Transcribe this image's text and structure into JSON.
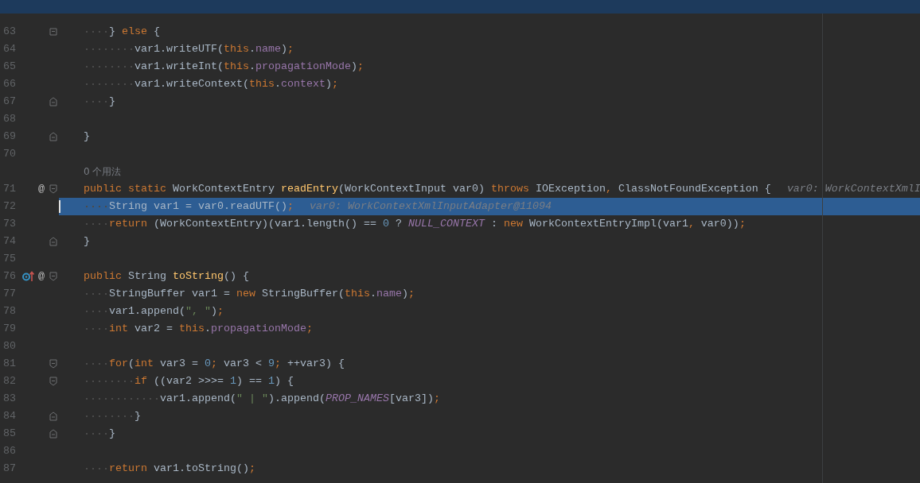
{
  "editor": {
    "rows": [
      {
        "kind": "code",
        "number": "63",
        "fold_start": true,
        "fold_end": true,
        "tokens": [
          {
            "text": "    } ",
            "kind": "plain"
          },
          {
            "text": "else",
            "kind": "keyword"
          },
          {
            "text": " {",
            "kind": "plain"
          }
        ]
      },
      {
        "kind": "code",
        "number": "64",
        "tokens": [
          {
            "text": "        var1.writeUTF(",
            "kind": "plain"
          },
          {
            "text": "this",
            "kind": "keyword"
          },
          {
            "text": ".",
            "kind": "plain"
          },
          {
            "text": "name",
            "kind": "field"
          },
          {
            "text": ")",
            "kind": "plain"
          },
          {
            "text": ";",
            "kind": "keyword"
          }
        ]
      },
      {
        "kind": "code",
        "number": "65",
        "tokens": [
          {
            "text": "        var1.writeInt(",
            "kind": "plain"
          },
          {
            "text": "this",
            "kind": "keyword"
          },
          {
            "text": ".",
            "kind": "plain"
          },
          {
            "text": "propagationMode",
            "kind": "field"
          },
          {
            "text": ")",
            "kind": "plain"
          },
          {
            "text": ";",
            "kind": "keyword"
          }
        ]
      },
      {
        "kind": "code",
        "number": "66",
        "tokens": [
          {
            "text": "        var1.writeContext(",
            "kind": "plain"
          },
          {
            "text": "this",
            "kind": "keyword"
          },
          {
            "text": ".",
            "kind": "plain"
          },
          {
            "text": "context",
            "kind": "field"
          },
          {
            "text": ")",
            "kind": "plain"
          },
          {
            "text": ";",
            "kind": "keyword"
          }
        ]
      },
      {
        "kind": "code",
        "number": "67",
        "fold_end": true,
        "tokens": [
          {
            "text": "    }",
            "kind": "plain"
          }
        ]
      },
      {
        "kind": "code",
        "number": "68"
      },
      {
        "kind": "code",
        "number": "69",
        "fold_end": true,
        "tokens": [
          {
            "text": "}",
            "kind": "plain"
          }
        ]
      },
      {
        "kind": "code",
        "number": "70"
      },
      {
        "kind": "usages",
        "text": "0 个用法"
      },
      {
        "kind": "code",
        "number": "71",
        "fold_start": true,
        "markers": [
          {
            "kind": "text",
            "text": "@"
          }
        ],
        "tokens": [
          {
            "text": "public",
            "kind": "keyword"
          },
          {
            "text": " static",
            "kind": "keyword"
          },
          {
            "text": " WorkContextEntry ",
            "kind": "plain"
          },
          {
            "text": "readEntry",
            "kind": "method"
          },
          {
            "text": "(WorkContextInput var0) ",
            "kind": "plain"
          },
          {
            "text": "throws",
            "kind": "keyword"
          },
          {
            "text": " IOException",
            "kind": "plain"
          },
          {
            "text": ",",
            "kind": "keyword"
          },
          {
            "text": " ClassNotFoundException {",
            "kind": "plain"
          }
        ],
        "hint": "var0: WorkContextXmlI"
      },
      {
        "kind": "code",
        "number": "72",
        "current": true,
        "tokens": [
          {
            "text": "    String var1 = var0.readUTF()",
            "kind": "plain"
          },
          {
            "text": ";",
            "kind": "keyword"
          }
        ],
        "hint": "var0: WorkContextXmlInputAdapter@11094"
      },
      {
        "kind": "code",
        "number": "73",
        "tokens": [
          {
            "text": "    return",
            "kind": "keyword"
          },
          {
            "text": " (WorkContextEntry)(var1.length() == ",
            "kind": "plain"
          },
          {
            "text": "0",
            "kind": "number"
          },
          {
            "text": " ? ",
            "kind": "plain"
          },
          {
            "text": "NULL_CONTEXT",
            "kind": "constant"
          },
          {
            "text": " : ",
            "kind": "plain"
          },
          {
            "text": "new",
            "kind": "keyword"
          },
          {
            "text": " WorkContextEntryImpl(var1",
            "kind": "plain"
          },
          {
            "text": ",",
            "kind": "keyword"
          },
          {
            "text": " var0))",
            "kind": "plain"
          },
          {
            "text": ";",
            "kind": "keyword"
          }
        ]
      },
      {
        "kind": "code",
        "number": "74",
        "fold_end": true,
        "tokens": [
          {
            "text": "}",
            "kind": "plain"
          }
        ]
      },
      {
        "kind": "code",
        "number": "75"
      },
      {
        "kind": "code",
        "number": "76",
        "fold_start": true,
        "markers": [
          {
            "kind": "overrides"
          },
          {
            "kind": "text",
            "text": "@"
          }
        ],
        "tokens": [
          {
            "text": "public",
            "kind": "keyword"
          },
          {
            "text": " String ",
            "kind": "plain"
          },
          {
            "text": "toString",
            "kind": "method"
          },
          {
            "text": "() {",
            "kind": "plain"
          }
        ]
      },
      {
        "kind": "code",
        "number": "77",
        "tokens": [
          {
            "text": "    StringBuffer var1 = ",
            "kind": "plain"
          },
          {
            "text": "new",
            "kind": "keyword"
          },
          {
            "text": " StringBuffer(",
            "kind": "plain"
          },
          {
            "text": "this",
            "kind": "keyword"
          },
          {
            "text": ".",
            "kind": "plain"
          },
          {
            "text": "name",
            "kind": "field"
          },
          {
            "text": ")",
            "kind": "plain"
          },
          {
            "text": ";",
            "kind": "keyword"
          }
        ]
      },
      {
        "kind": "code",
        "number": "78",
        "tokens": [
          {
            "text": "    var1.append(",
            "kind": "plain"
          },
          {
            "text": "\", \"",
            "kind": "string"
          },
          {
            "text": ")",
            "kind": "plain"
          },
          {
            "text": ";",
            "kind": "keyword"
          }
        ]
      },
      {
        "kind": "code",
        "number": "79",
        "tokens": [
          {
            "text": "    int",
            "kind": "keyword"
          },
          {
            "text": " var2 = ",
            "kind": "plain"
          },
          {
            "text": "this",
            "kind": "keyword"
          },
          {
            "text": ".",
            "kind": "plain"
          },
          {
            "text": "propagationMode",
            "kind": "field"
          },
          {
            "text": ";",
            "kind": "keyword"
          }
        ]
      },
      {
        "kind": "code",
        "number": "80"
      },
      {
        "kind": "code",
        "number": "81",
        "fold_start": true,
        "tokens": [
          {
            "text": "    for",
            "kind": "keyword"
          },
          {
            "text": "(",
            "kind": "plain"
          },
          {
            "text": "int",
            "kind": "keyword"
          },
          {
            "text": " var3 = ",
            "kind": "plain"
          },
          {
            "text": "0",
            "kind": "number"
          },
          {
            "text": ";",
            "kind": "keyword"
          },
          {
            "text": " var3 < ",
            "kind": "plain"
          },
          {
            "text": "9",
            "kind": "number"
          },
          {
            "text": ";",
            "kind": "keyword"
          },
          {
            "text": " ++var3) {",
            "kind": "plain"
          }
        ]
      },
      {
        "kind": "code",
        "number": "82",
        "fold_start": true,
        "tokens": [
          {
            "text": "        if",
            "kind": "keyword"
          },
          {
            "text": " ((var2 >>>= ",
            "kind": "plain"
          },
          {
            "text": "1",
            "kind": "number"
          },
          {
            "text": ") == ",
            "kind": "plain"
          },
          {
            "text": "1",
            "kind": "number"
          },
          {
            "text": ") {",
            "kind": "plain"
          }
        ]
      },
      {
        "kind": "code",
        "number": "83",
        "tokens": [
          {
            "text": "            var1.append(",
            "kind": "plain"
          },
          {
            "text": "\" | \"",
            "kind": "string"
          },
          {
            "text": ").append(",
            "kind": "plain"
          },
          {
            "text": "PROP_NAMES",
            "kind": "constant"
          },
          {
            "text": "[var3])",
            "kind": "plain"
          },
          {
            "text": ";",
            "kind": "keyword"
          }
        ]
      },
      {
        "kind": "code",
        "number": "84",
        "fold_end": true,
        "tokens": [
          {
            "text": "        }",
            "kind": "plain"
          }
        ]
      },
      {
        "kind": "code",
        "number": "85",
        "fold_end": true,
        "tokens": [
          {
            "text": "    }",
            "kind": "plain"
          }
        ]
      },
      {
        "kind": "code",
        "number": "86"
      },
      {
        "kind": "code",
        "number": "87",
        "tokens": [
          {
            "text": "    return",
            "kind": "keyword"
          },
          {
            "text": " var1.toString()",
            "kind": "plain"
          },
          {
            "text": ";",
            "kind": "keyword"
          }
        ]
      }
    ]
  }
}
